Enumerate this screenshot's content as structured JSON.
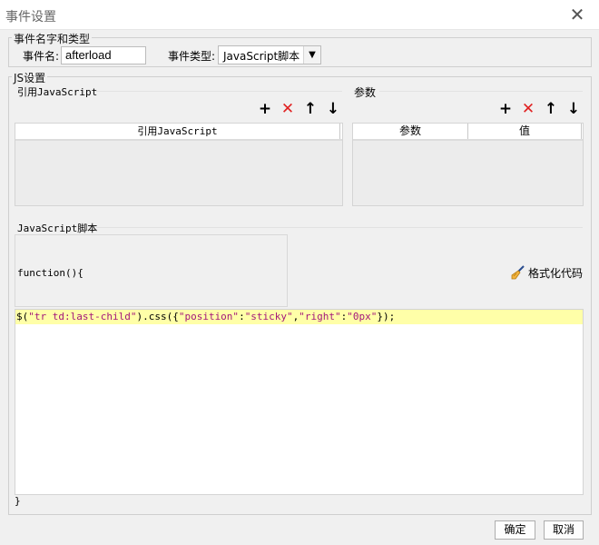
{
  "window": {
    "title": "事件设置"
  },
  "event_group": {
    "legend": "事件名字和类型",
    "name_label": "事件名:",
    "name_value": "afterload",
    "type_label": "事件类型:",
    "type_value": "JavaScript脚本"
  },
  "js_group": {
    "legend": "JS设置",
    "ref_section": {
      "label": "引用JavaScript",
      "columns": [
        "引用JavaScript"
      ]
    },
    "param_section": {
      "label": "参数",
      "columns": [
        "参数",
        "值"
      ]
    },
    "icons": {
      "add": "+",
      "delete": "✕",
      "up": "↑",
      "down": "↓"
    },
    "script_section": {
      "label": "JavaScript脚本",
      "fn_header": "function(){",
      "code_parts": [
        {
          "text": "$(",
          "kind": "plain"
        },
        {
          "text": "\"tr td:last-child\"",
          "kind": "str"
        },
        {
          "text": ").css({",
          "kind": "plain"
        },
        {
          "text": "\"position\"",
          "kind": "str"
        },
        {
          "text": ":",
          "kind": "plain"
        },
        {
          "text": "\"sticky\"",
          "kind": "str"
        },
        {
          "text": ",",
          "kind": "plain"
        },
        {
          "text": "\"right\"",
          "kind": "str"
        },
        {
          "text": ":",
          "kind": "plain"
        },
        {
          "text": "\"0px\"",
          "kind": "str"
        },
        {
          "text": "});",
          "kind": "plain"
        }
      ],
      "fn_footer": "}",
      "format_label": "格式化代码"
    }
  },
  "footer": {
    "ok_label": "确定",
    "cancel_label": "取消"
  },
  "colors": {
    "delete_red": "#e02020",
    "highlight_line": "#ffffa8",
    "string_token": "#a3177a"
  }
}
